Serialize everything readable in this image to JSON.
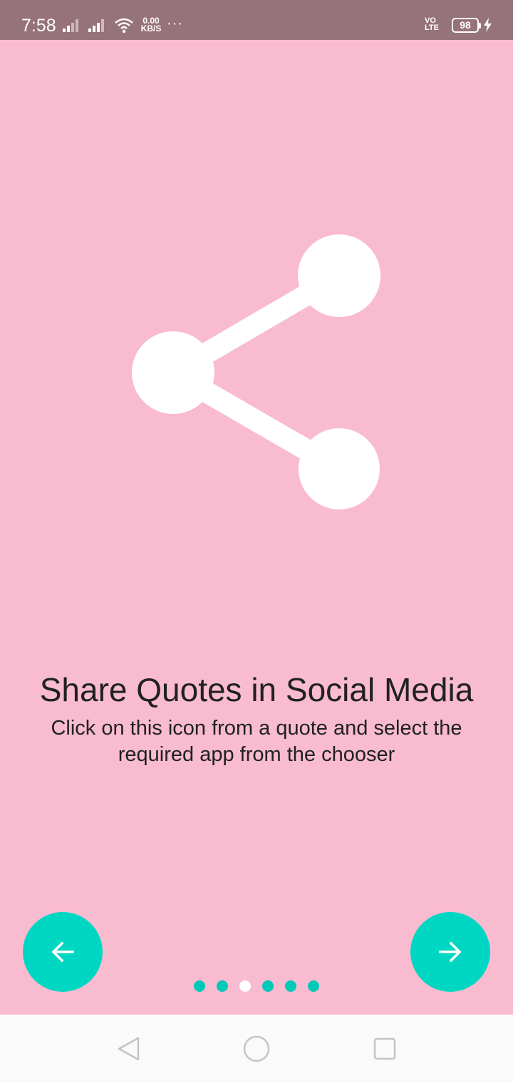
{
  "status_bar": {
    "time": "7:58",
    "net_speed_value": "0.00",
    "net_speed_unit": "KB/S",
    "more": "···",
    "volte_top": "VO",
    "volte_bottom": "LTE",
    "battery": "98",
    "icons": [
      "signal-icon",
      "signal-icon",
      "wifi-icon",
      "charging-bolt-icon"
    ]
  },
  "onboarding": {
    "illustration_icon": "share-icon",
    "title": "Share Quotes in Social Media",
    "description": "Click on this icon from a quote and select the required app from the chooser",
    "back_icon": "arrow-left-icon",
    "next_icon": "arrow-right-icon",
    "page_count": 6,
    "current_page": 3
  },
  "nav_bar": {
    "buttons": [
      "back-triangle-icon",
      "home-circle-icon",
      "recents-square-icon"
    ]
  },
  "colors": {
    "status_bar": "#96727b",
    "background": "#f8bbd0",
    "accent": "#00d7c3",
    "nav_bar": "#fafafa",
    "text": "#212121"
  }
}
